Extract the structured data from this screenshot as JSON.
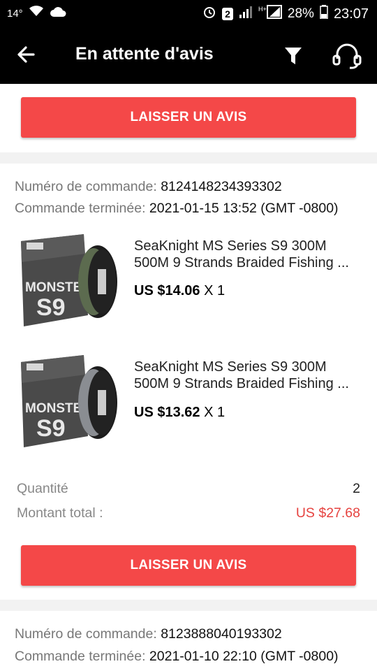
{
  "status_bar": {
    "temperature": "14°",
    "battery": "28%",
    "time": "23:07",
    "sim_badge": "2"
  },
  "header": {
    "title": "En attente d'avis"
  },
  "review_button_label": "LAISSER UN AVIS",
  "orders": [
    {
      "order_label": "Numéro de commande:",
      "order_number": "8124148234393302",
      "completed_label": "Commande terminée:",
      "completed_date": "2021-01-15 13:52 (GMT -0800)",
      "items": [
        {
          "title_line1": "SeaKnight MS Series S9 300M",
          "title_line2": "500M 9 Strands Braided Fishing ...",
          "price": "US $14.06",
          "qty": "X 1",
          "box_text": "MONSTER",
          "box_code": "S9",
          "spool_color": "#5c6b4f"
        },
        {
          "title_line1": "SeaKnight MS Series S9 300M",
          "title_line2": "500M 9 Strands Braided Fishing ...",
          "price": "US $13.62",
          "qty": "X 1",
          "box_text": "MONSTER",
          "box_code": "S9",
          "spool_color": "#8a8d92"
        }
      ],
      "quantity_label": "Quantité",
      "quantity_value": "2",
      "total_label": "Montant total :",
      "total_value": "US $27.68"
    },
    {
      "order_label": "Numéro de commande:",
      "order_number": "8123888040193302",
      "completed_label": "Commande terminée:",
      "completed_date": "2021-01-10 22:10 (GMT -0800)"
    }
  ],
  "colors": {
    "accent": "#f44848",
    "total": "#e64340",
    "header_bg": "#000000"
  }
}
